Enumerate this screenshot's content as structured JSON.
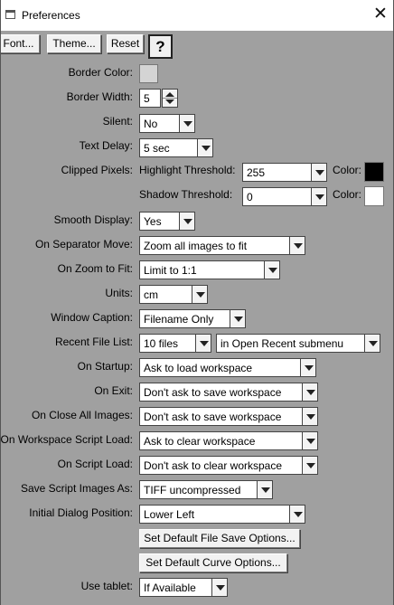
{
  "window": {
    "title": "Preferences",
    "close_glyph": "✕"
  },
  "toolbar": {
    "font": "Font...",
    "theme": "Theme...",
    "reset": "Reset",
    "help": "?"
  },
  "border_color": {
    "label": "Border Color:",
    "color": "#d4d4d4"
  },
  "border_width": {
    "label": "Border Width:",
    "value": "5"
  },
  "silent": {
    "label": "Silent:",
    "value": "No"
  },
  "text_delay": {
    "label": "Text Delay:",
    "value": "5 sec"
  },
  "clipped_pixels": {
    "label": "Clipped Pixels:",
    "highlight_label": "Highlight Threshold:",
    "highlight_value": "255",
    "highlight_color_label": "Color:",
    "highlight_color": "#000000",
    "shadow_label": "Shadow Threshold:",
    "shadow_value": "0",
    "shadow_color_label": "Color:",
    "shadow_color": "#ffffff"
  },
  "smooth_display": {
    "label": "Smooth Display:",
    "value": "Yes"
  },
  "on_separator_move": {
    "label": "On Separator Move:",
    "value": "Zoom all images to fit"
  },
  "on_zoom_to_fit": {
    "label": "On Zoom to Fit:",
    "value": "Limit to 1:1"
  },
  "units": {
    "label": "Units:",
    "value": "cm"
  },
  "window_caption": {
    "label": "Window Caption:",
    "value": "Filename Only"
  },
  "recent_file_list": {
    "label": "Recent File List:",
    "count": "10 files",
    "location": "in Open Recent submenu"
  },
  "on_startup": {
    "label": "On Startup:",
    "value": "Ask to load workspace"
  },
  "on_exit": {
    "label": "On Exit:",
    "value": "Don't ask to save workspace"
  },
  "on_close_all": {
    "label": "On Close All Images:",
    "value": "Don't ask to save workspace"
  },
  "on_ws_script_load": {
    "label": "On Workspace Script Load:",
    "value": "Ask to clear workspace"
  },
  "on_script_load": {
    "label": "On Script Load:",
    "value": "Don't ask to clear workspace"
  },
  "save_script_images": {
    "label": "Save Script Images As:",
    "value": "TIFF uncompressed"
  },
  "initial_dialog_pos": {
    "label": "Initial Dialog Position:",
    "value": "Lower Left"
  },
  "buttons": {
    "file_save": "Set Default File Save Options...",
    "curve": "Set Default Curve Options..."
  },
  "use_tablet": {
    "label": "Use tablet:",
    "value": "If Available"
  }
}
